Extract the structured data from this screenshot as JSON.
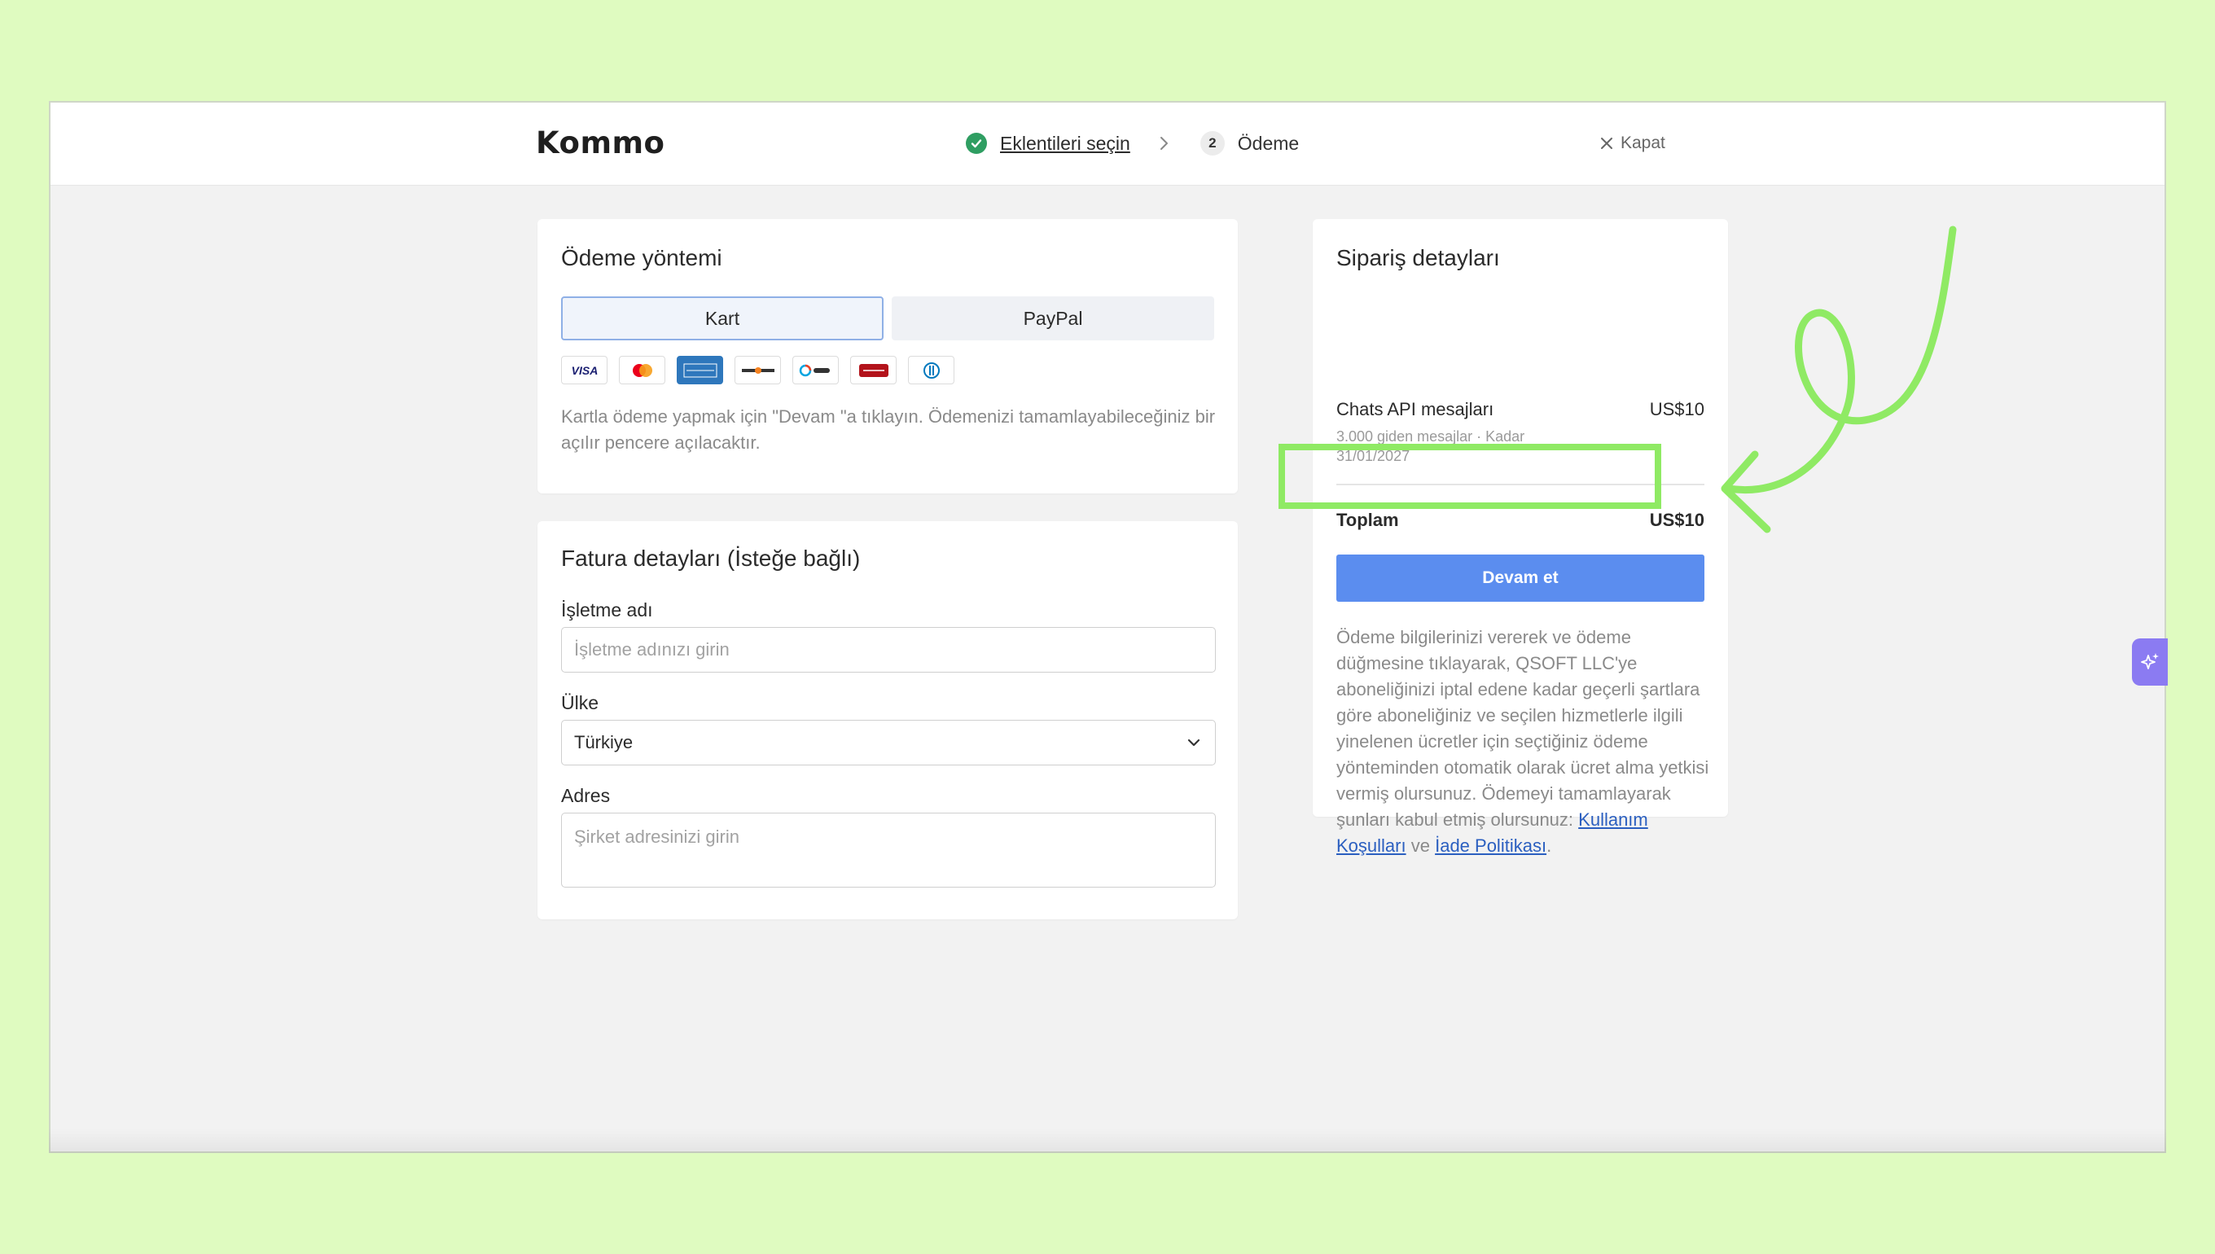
{
  "header": {
    "logo_text": "Kommo",
    "step1_label": "Eklentileri seçin",
    "step2_number": "2",
    "step2_label": "Ödeme",
    "close_label": "Kapat"
  },
  "payment": {
    "title": "Ödeme yöntemi",
    "tabs": [
      {
        "label": "Kart",
        "active": true
      },
      {
        "label": "PayPal",
        "active": false
      }
    ],
    "card_logos": [
      "visa-logo",
      "mastercard-logo",
      "amex-logo",
      "discover-logo",
      "elo-logo",
      "hipercard-logo",
      "diners-logo"
    ],
    "note": "Kartla ödeme yapmak için \"Devam \"a tıklayın. Ödemenizi tamamlayabileceğiniz bir açılır pencere açılacaktır."
  },
  "billing": {
    "title": "Fatura detayları (İsteğe bağlı)",
    "business_label": "İşletme adı",
    "business_placeholder": "İşletme adınızı girin",
    "business_value": "",
    "country_label": "Ülke",
    "country_value": "Türkiye",
    "address_label": "Adres",
    "address_placeholder": "Şirket adresinizi girin",
    "address_value": ""
  },
  "order": {
    "title": "Sipariş detayları",
    "item_name": "Chats API mesajları",
    "item_price": "US$10",
    "item_sub": "3.000 giden mesajlar · Kadar 31/01/2027",
    "total_label": "Toplam",
    "total_value": "US$10",
    "continue_label": "Devam et",
    "legal_text": "Ödeme bilgilerinizi vererek ve ödeme düğmesine tıklayarak, QSOFT LLC'ye aboneliğinizi iptal edene kadar geçerli şartlara göre aboneliğiniz ve seçilen hizmetlerle ilgili yinelenen ücretler için seçtiğiniz ödeme yönteminden otomatik olarak ücret alma yetkisi vermiş olursunuz. Ödemeyi tamamlayarak şunları kabul etmiş olursunuz:",
    "terms_link": "Kullanım Koşulları",
    "and_text": "ve",
    "refund_link": "İade Politikası",
    "period": "."
  },
  "colors": {
    "accent": "#5b8def",
    "highlight": "#8fea64",
    "background": "#dffbc0",
    "success": "#2f9e62",
    "ai_button": "#8b7bf2"
  }
}
